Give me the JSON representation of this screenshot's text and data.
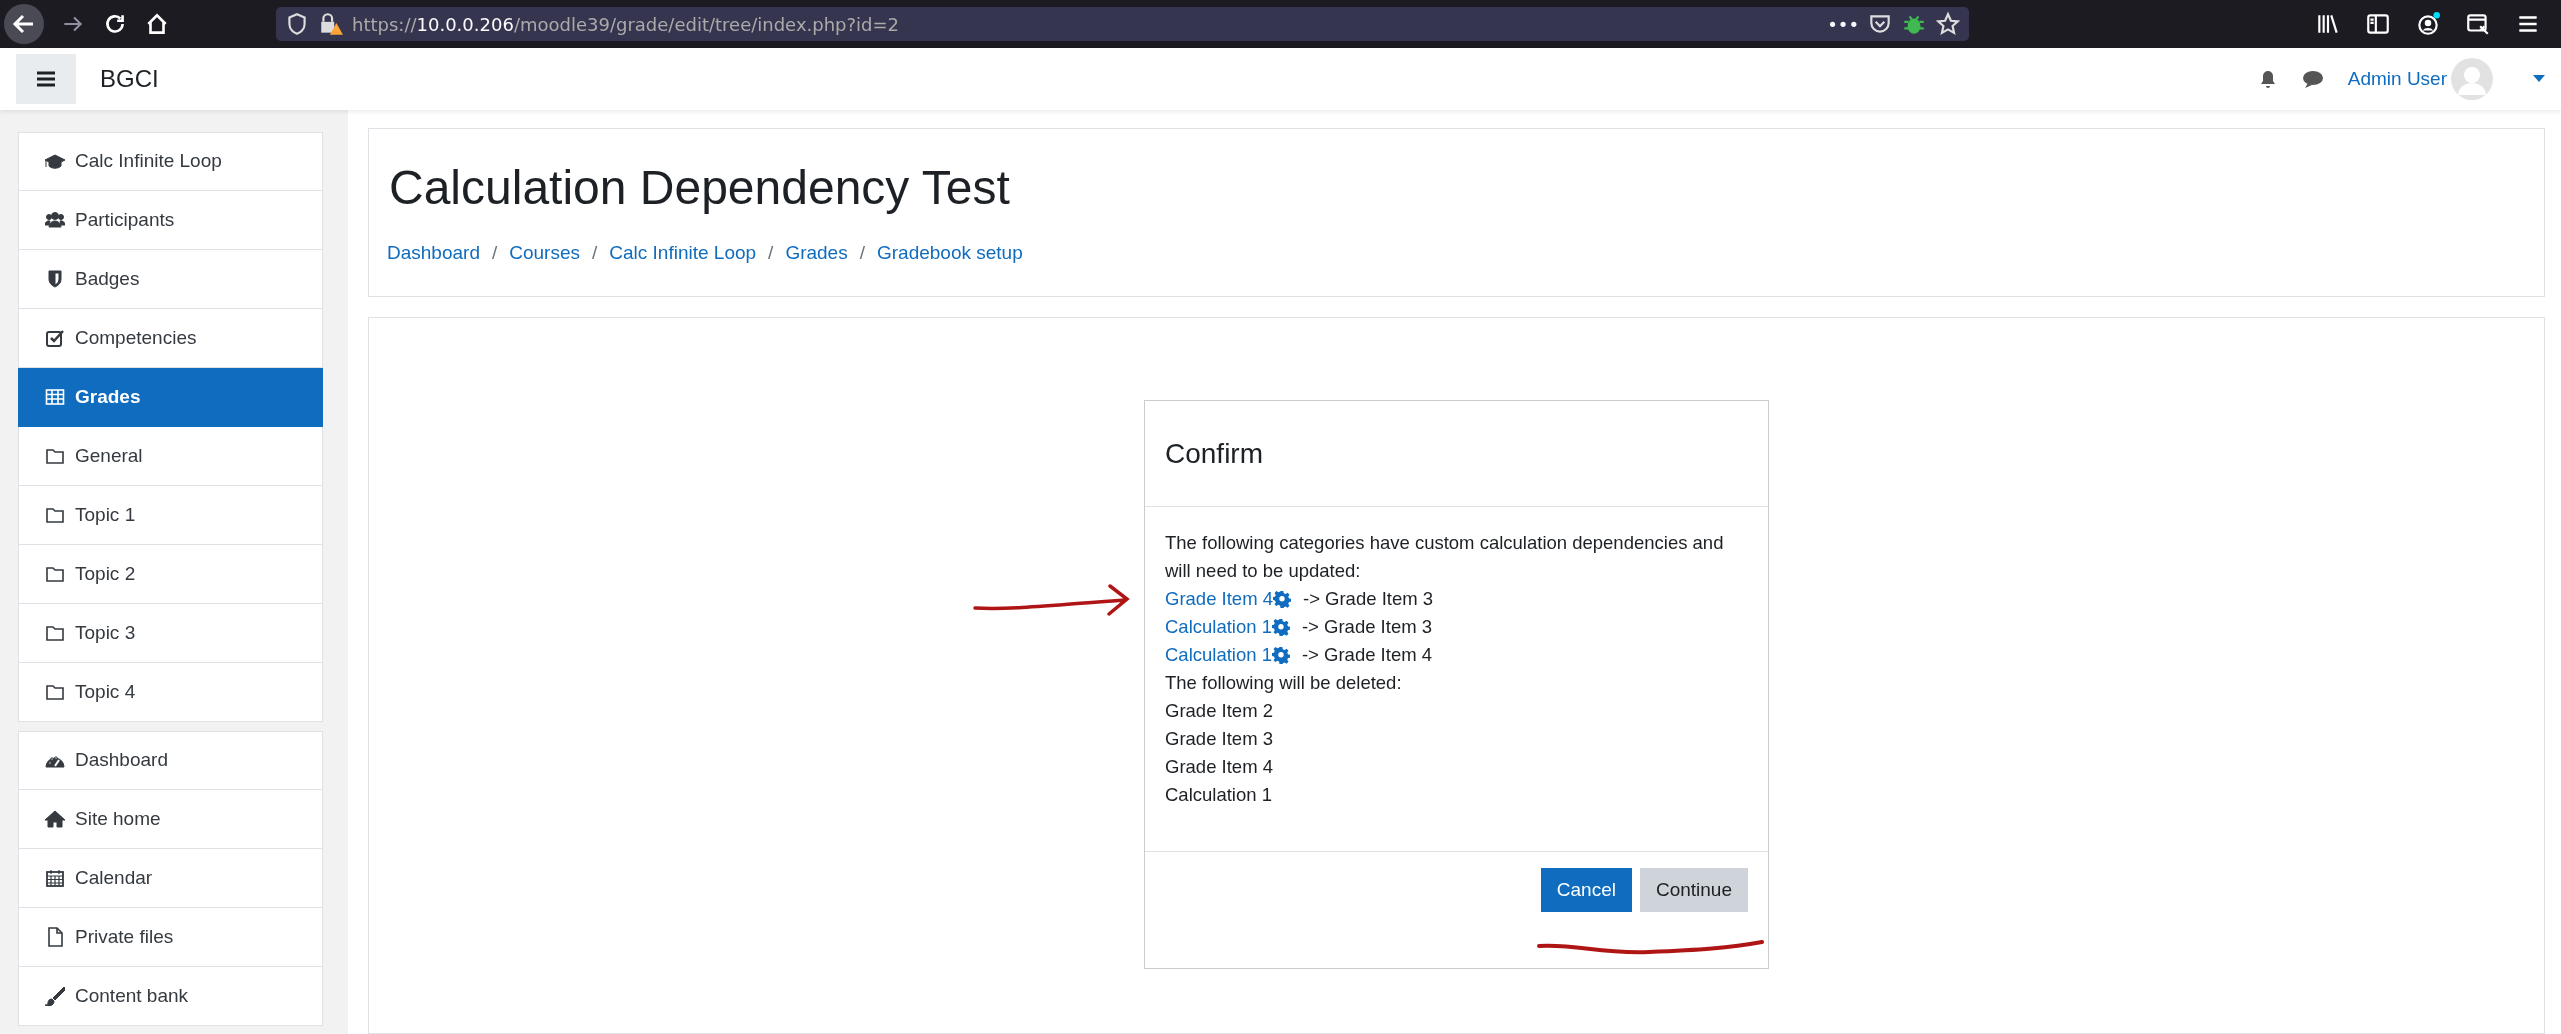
{
  "browser": {
    "url": {
      "scheme": "https://",
      "host": "10.0.0.206",
      "path": "/moodle39/grade/edit/tree/index.php?id=2"
    },
    "page_actions": "•••"
  },
  "navbar": {
    "brand": "BGCI",
    "user": "Admin User"
  },
  "sidebar": {
    "groups": [
      [
        {
          "label": "Calc Infinite Loop",
          "kind": "cap",
          "selected": false
        },
        {
          "label": "Participants",
          "kind": "users",
          "selected": false
        },
        {
          "label": "Badges",
          "kind": "shield",
          "selected": false
        },
        {
          "label": "Competencies",
          "kind": "check",
          "selected": false
        },
        {
          "label": "Grades",
          "kind": "table",
          "selected": true
        },
        {
          "label": "General",
          "kind": "folder",
          "selected": false
        },
        {
          "label": "Topic 1",
          "kind": "folder",
          "selected": false
        },
        {
          "label": "Topic 2",
          "kind": "folder",
          "selected": false
        },
        {
          "label": "Topic 3",
          "kind": "folder",
          "selected": false
        },
        {
          "label": "Topic 4",
          "kind": "folder",
          "selected": false
        }
      ],
      [
        {
          "label": "Dashboard",
          "kind": "gauge",
          "selected": false
        },
        {
          "label": "Site home",
          "kind": "home",
          "selected": false
        },
        {
          "label": "Calendar",
          "kind": "calendar",
          "selected": false
        },
        {
          "label": "Private files",
          "kind": "file",
          "selected": false
        },
        {
          "label": "Content bank",
          "kind": "brush",
          "selected": false
        }
      ]
    ]
  },
  "page_header": {
    "title": "Calculation Dependency Test",
    "breadcrumb": [
      "Dashboard",
      "Courses",
      "Calc Infinite Loop",
      "Grades",
      "Gradebook setup"
    ],
    "breadcrumb_separator": "/"
  },
  "dialog": {
    "title": "Confirm",
    "intro": "The following categories have custom calculation dependencies and will need to be updated:",
    "dependencies": [
      {
        "item": "Grade Item 4",
        "target": "-> Grade Item 3"
      },
      {
        "item": "Calculation 1",
        "target": "-> Grade Item 3"
      },
      {
        "item": "Calculation 1",
        "target": "-> Grade Item 4"
      }
    ],
    "deleted_heading": "The following will be deleted:",
    "deleted": [
      "Grade Item 2",
      "Grade Item 3",
      "Grade Item 4",
      "Calculation 1"
    ],
    "buttons": [
      {
        "label": "Cancel",
        "kind": "primary"
      },
      {
        "label": "Continue",
        "kind": "secondary"
      }
    ]
  }
}
